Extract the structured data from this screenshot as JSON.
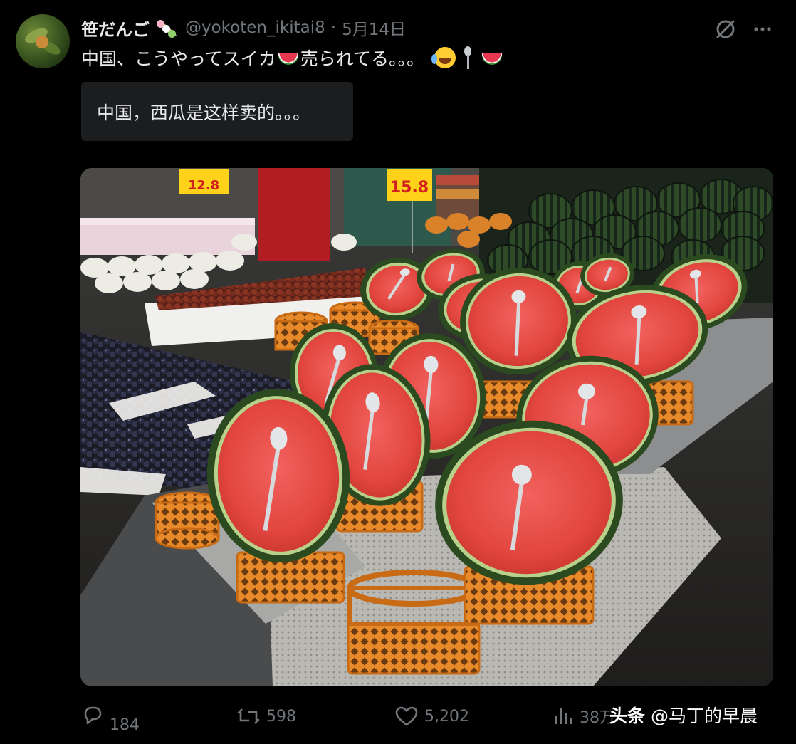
{
  "author": {
    "display_name": "笹だんご",
    "handle": "@yokoten_ikitai8",
    "separator": "·",
    "date": "5月14日"
  },
  "tweet": {
    "text_before_emoji": "中国、こうやってスイカ",
    "text_after_emoji": "売られてる。。。",
    "translation": "中国，西瓜是这样卖的。。。"
  },
  "media": {
    "price_sign_left": "12.8",
    "price_sign_center": "15.8"
  },
  "metrics": {
    "replies": "184",
    "reposts": "598",
    "likes": "5,202",
    "views": "38万"
  },
  "watermark": {
    "source": "头条",
    "account": "@马丁的早晨"
  },
  "colors": {
    "background": "#000000",
    "text_primary": "#e7e9ea",
    "text_secondary": "#71767b",
    "translation_bg": "#1c1d1f"
  },
  "icons": [
    "grok-icon",
    "more-icon",
    "reply-icon",
    "retweet-icon",
    "like-icon",
    "views-icon"
  ]
}
